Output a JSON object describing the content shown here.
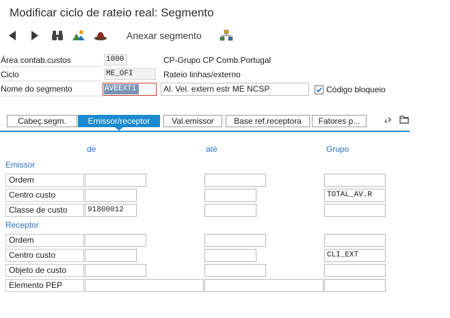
{
  "window": {
    "title": "Modificar ciclo de rateio real: Segmento"
  },
  "toolbar": {
    "icons": [
      "arrow-left-icon",
      "arrow-right-icon",
      "binoculars-icon",
      "mountains-icon",
      "hat-icon",
      "hierarchy-icon"
    ],
    "attach_segment_label": "Anexar segmento"
  },
  "header": {
    "area_label": "Área contab.custos",
    "area_value": "1000",
    "area_desc": "CP-Grupo CP Comb.Portugal",
    "cycle_label": "Ciclo",
    "cycle_value": "ME_OFI",
    "cycle_desc": "Rateio linhas/externo",
    "segment_label": "Nome do segmento",
    "segment_value": "AVEEXT1",
    "segment_desc": "Al. Vel. extern estr ME NCSP",
    "lock_label": "Código bloqueio",
    "lock_checked": true
  },
  "tabs": [
    "Cabeç.segm.",
    "Emissor/receptor",
    "Val.emissor",
    "Base ref.receptora",
    "Fatores p..."
  ],
  "tab_active": "Emissor/receptor",
  "columns": {
    "from": "de",
    "to": "até",
    "group": "Grupo"
  },
  "sender": {
    "title": "Emissor",
    "rows": [
      {
        "label": "Ordem",
        "from": "",
        "to": "",
        "group": ""
      },
      {
        "label": "Centro custo",
        "from": "",
        "to": "",
        "group": "TOTAL_AV.R"
      },
      {
        "label": "Classe de custo",
        "from": "91800012",
        "to": "",
        "group": ""
      }
    ]
  },
  "receiver": {
    "title": "Receptor",
    "rows": [
      {
        "label": "Ordem",
        "from": "",
        "to": "",
        "group": ""
      },
      {
        "label": "Centro custo",
        "from": "",
        "to": "",
        "group": "CLI_EXT"
      },
      {
        "label": "Objeto de custo",
        "from": "",
        "to": "",
        "group": ""
      },
      {
        "label": "Elemento PEP",
        "from": "",
        "to": "",
        "group": ""
      }
    ]
  },
  "colors": {
    "accent": "#1a8ad0",
    "section_text": "#2a6fc0",
    "selection": "#7c94b5"
  }
}
